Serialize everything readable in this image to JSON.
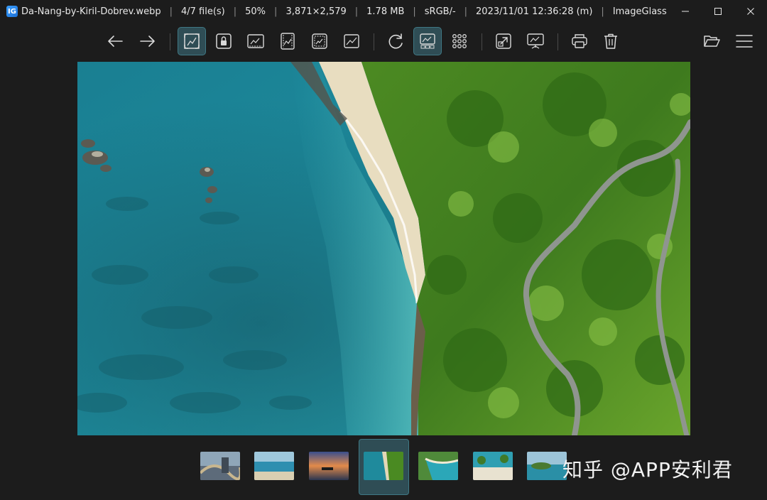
{
  "window": {
    "file_name": "Da-Nang-by-Kiril-Dobrev.webp",
    "file_index": "4/7 file(s)",
    "zoom": "50%",
    "dimensions": "3,871×2,579",
    "file_size": "1.78 MB",
    "color_profile": "sRGB/-",
    "date": "2023/11/01 12:36:28 (m)",
    "app_name": "ImageGlass",
    "app_icon_glyph": "IG"
  },
  "toolbar": {
    "tools": [
      {
        "name": "back-arrow-icon",
        "active": false
      },
      {
        "name": "forward-arrow-icon",
        "active": false
      },
      {
        "name": "auto-zoom-icon",
        "active": true
      },
      {
        "name": "lock-zoom-icon",
        "active": false
      },
      {
        "name": "scale-to-width-icon",
        "active": false
      },
      {
        "name": "scale-to-height-icon",
        "active": false
      },
      {
        "name": "scale-to-fit-icon",
        "active": false
      },
      {
        "name": "scale-to-fill-icon",
        "active": false
      },
      {
        "name": "refresh-icon",
        "active": false
      },
      {
        "name": "gallery-icon",
        "active": true
      },
      {
        "name": "grid-icon",
        "active": false
      },
      {
        "name": "fullscreen-icon",
        "active": false
      },
      {
        "name": "slideshow-icon",
        "active": false
      },
      {
        "name": "print-icon",
        "active": false
      },
      {
        "name": "delete-icon",
        "active": false
      },
      {
        "name": "open-folder-icon",
        "active": false
      },
      {
        "name": "menu-icon",
        "active": false
      }
    ]
  },
  "thumbnails": {
    "items": [
      "thumbnail-1",
      "thumbnail-2",
      "thumbnail-3",
      "thumbnail-4",
      "thumbnail-5",
      "thumbnail-6",
      "thumbnail-7"
    ],
    "active_index": 3
  },
  "watermark": {
    "text": "知乎 @APP安利君"
  },
  "colors": {
    "background": "#1c1c1c",
    "active_tool": "#2f4d55",
    "active_border": "#3f7884",
    "icon": "#d9d9d9"
  }
}
